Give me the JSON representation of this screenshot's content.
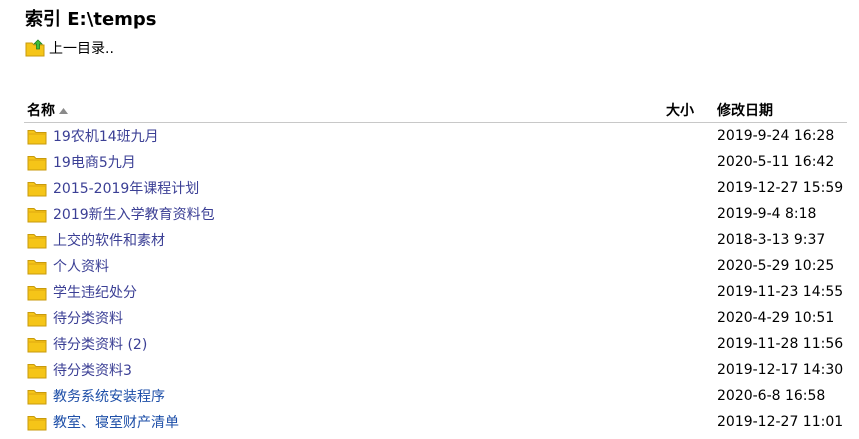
{
  "page": {
    "title": "索引 E:\\temps",
    "parent_link_label": "上一目录.."
  },
  "table": {
    "columns": {
      "name": "名称",
      "size": "大小",
      "modified": "修改日期"
    },
    "sort": {
      "column": "name",
      "direction": "ascending"
    },
    "rows": [
      {
        "name": "19农机14班九月",
        "size": "",
        "modified": "2019-9-24 16:28"
      },
      {
        "name": "19电商5九月",
        "size": "",
        "modified": "2020-5-11 16:42"
      },
      {
        "name": "2015-2019年课程计划",
        "size": "",
        "modified": "2019-12-27 15:59"
      },
      {
        "name": "2019新生入学教育资料包",
        "size": "",
        "modified": "2019-9-4 8:18"
      },
      {
        "name": "上交的软件和素材",
        "size": "",
        "modified": "2018-3-13 9:37"
      },
      {
        "name": "个人资料",
        "size": "",
        "modified": "2020-5-29 10:25"
      },
      {
        "name": "学生违纪处分",
        "size": "",
        "modified": "2019-11-23 14:55"
      },
      {
        "name": "待分类资料",
        "size": "",
        "modified": "2020-4-29 10:51"
      },
      {
        "name": "待分类资料 (2)",
        "size": "",
        "modified": "2019-11-28 11:56"
      },
      {
        "name": "待分类资料3",
        "size": "",
        "modified": "2019-12-17 14:30"
      },
      {
        "name": "教务系统安装程序",
        "size": "",
        "modified": "2020-6-8 16:58"
      },
      {
        "name": "教室、寝室财产清单",
        "size": "",
        "modified": "2019-12-27 11:01"
      }
    ]
  },
  "icons": {
    "parent": "folder-up-icon",
    "folder": "folder-icon",
    "sort": "sort-ascending-icon"
  },
  "colors": {
    "link": "#3b3f95",
    "link_alt": "#1e4fa8",
    "folder_fill": "#f5c518",
    "folder_border": "#c89a0c",
    "header_rule": "#c8c8c8"
  }
}
